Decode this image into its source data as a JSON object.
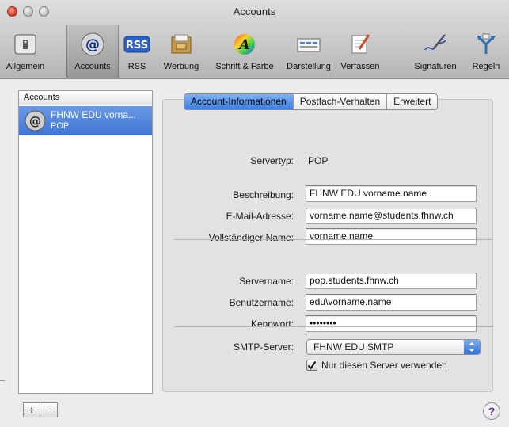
{
  "window": {
    "title": "Accounts"
  },
  "toolbar": {
    "items": [
      {
        "label": "Allgemein",
        "icon": "switch-icon"
      },
      {
        "label": "Accounts",
        "icon": "at-sign-icon"
      },
      {
        "label": "RSS",
        "icon": "rss-icon"
      },
      {
        "label": "Werbung",
        "icon": "junk-mail-icon"
      },
      {
        "label": "Schrift & Farbe",
        "icon": "font-color-icon"
      },
      {
        "label": "Darstellung",
        "icon": "viewing-icon"
      },
      {
        "label": "Verfassen",
        "icon": "compose-icon"
      },
      {
        "label": "Signaturen",
        "icon": "signature-icon"
      },
      {
        "label": "Regeln",
        "icon": "rules-icon"
      }
    ],
    "selected": "Accounts"
  },
  "accounts": {
    "header": "Accounts",
    "items": [
      {
        "name": "FHNW EDU vorna...",
        "type": "POP"
      }
    ],
    "add_label": "+",
    "remove_label": "−"
  },
  "tabs": [
    {
      "label": "Account-Informationen",
      "active": true
    },
    {
      "label": "Postfach-Verhalten",
      "active": false
    },
    {
      "label": "Erweitert",
      "active": false
    }
  ],
  "form": {
    "servertyp_label": "Servertyp:",
    "servertyp_value": "POP",
    "beschreibung_label": "Beschreibung:",
    "beschreibung_value": "FHNW EDU vorname.name",
    "email_label": "E-Mail-Adresse:",
    "email_value": "vorname.name@students.fhnw.ch",
    "fullname_label": "Vollständiger Name:",
    "fullname_value": "vorname.name",
    "servername_label": "Servername:",
    "servername_value": "pop.students.fhnw.ch",
    "username_label": "Benutzername:",
    "username_value": "edu\\vorname.name",
    "password_label": "Kennwort:",
    "password_value": "••••••••",
    "smtp_label": "SMTP-Server:",
    "smtp_value": "FHNW EDU SMTP",
    "only_server_label": "Nur diesen Server verwenden",
    "only_server_checked": true
  },
  "help_label": "?"
}
